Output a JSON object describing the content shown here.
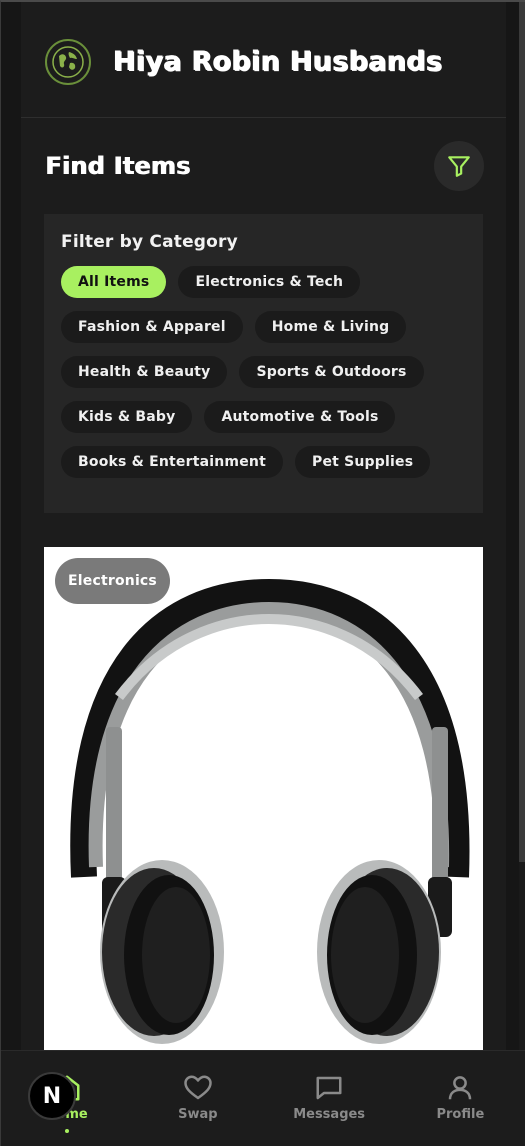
{
  "header": {
    "title": "Hiya Robin Husbands",
    "logo_icon": "globe-map-icon"
  },
  "find": {
    "title": "Find Items",
    "filter_icon": "filter-icon"
  },
  "filter_panel": {
    "title": "Filter by Category",
    "chips": [
      {
        "label": "All Items",
        "active": true
      },
      {
        "label": "Electronics & Tech",
        "active": false
      },
      {
        "label": "Fashion & Apparel",
        "active": false
      },
      {
        "label": "Home & Living",
        "active": false
      },
      {
        "label": "Health & Beauty",
        "active": false
      },
      {
        "label": "Sports & Outdoors",
        "active": false
      },
      {
        "label": "Kids & Baby",
        "active": false
      },
      {
        "label": "Automotive & Tools",
        "active": false
      },
      {
        "label": "Books & Entertainment",
        "active": false
      },
      {
        "label": "Pet Supplies",
        "active": false
      }
    ]
  },
  "item": {
    "category": "Electronics",
    "image_subject": "headphones"
  },
  "nav": {
    "items": [
      {
        "label": "Home",
        "icon": "home-icon",
        "active": true
      },
      {
        "label": "Swap",
        "icon": "heart-icon",
        "active": false
      },
      {
        "label": "Messages",
        "icon": "message-icon",
        "active": false
      },
      {
        "label": "Profile",
        "icon": "user-icon",
        "active": false
      }
    ]
  },
  "dev_badge": "N",
  "colors": {
    "accent": "#a8f060",
    "background": "#161616",
    "panel": "#262626",
    "chip": "#1b1b1b"
  }
}
